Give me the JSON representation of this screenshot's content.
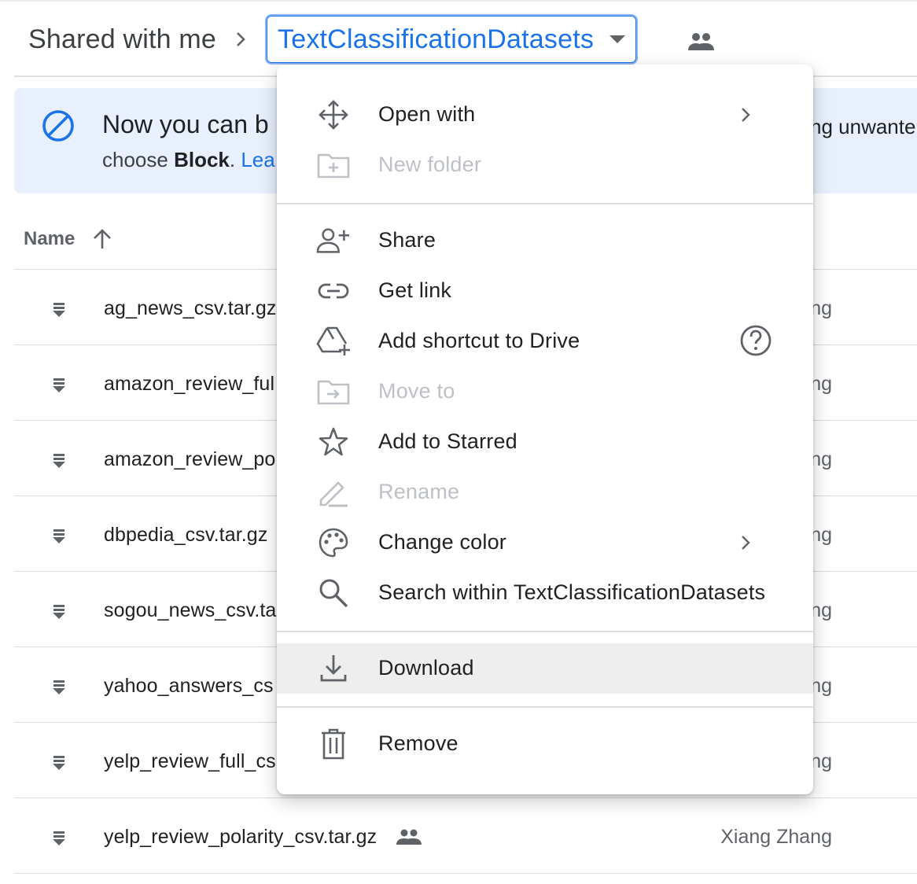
{
  "breadcrumb": {
    "root": "Shared with me",
    "separator_icon": "chevron-right-icon",
    "current": "TextClassificationDatasets",
    "caret_icon": "caret-down-icon",
    "shared_icon": "people-icon"
  },
  "banner": {
    "icon": "block-icon",
    "title": "Now you can b",
    "title_right": "ng unwante",
    "sub_text": "choose ",
    "sub_bold": "Block",
    "sub_after": ". ",
    "sub_link": "Lea"
  },
  "list": {
    "column_name": "Name",
    "sort_icon": "arrow-up-icon",
    "rows": [
      {
        "name": "ag_news_csv.tar.gz",
        "owner": "ng"
      },
      {
        "name": "amazon_review_ful",
        "owner": "ng"
      },
      {
        "name": "amazon_review_po",
        "owner": "ng"
      },
      {
        "name": "dbpedia_csv.tar.gz",
        "owner": "ng"
      },
      {
        "name": "sogou_news_csv.ta",
        "owner": "ng"
      },
      {
        "name": "yahoo_answers_cs",
        "owner": "ng"
      },
      {
        "name": "yelp_review_full_cs",
        "owner": "ng"
      },
      {
        "name": "yelp_review_polarity_csv.tar.gz",
        "owner": "Xiang Zhang"
      }
    ]
  },
  "menu": {
    "items": [
      {
        "label": "Open with",
        "icon": "move-arrows-icon",
        "disabled": false,
        "submenu": true
      },
      {
        "label": "New folder",
        "icon": "new-folder-icon",
        "disabled": true
      },
      {
        "label": "Share",
        "icon": "person-add-icon",
        "disabled": false
      },
      {
        "label": "Get link",
        "icon": "link-icon",
        "disabled": false
      },
      {
        "label": "Add shortcut to Drive",
        "icon": "drive-shortcut-icon",
        "disabled": false,
        "help": true
      },
      {
        "label": "Move to",
        "icon": "move-to-folder-icon",
        "disabled": true
      },
      {
        "label": "Add to Starred",
        "icon": "star-icon",
        "disabled": false
      },
      {
        "label": "Rename",
        "icon": "pencil-icon",
        "disabled": true
      },
      {
        "label": "Change color",
        "icon": "palette-icon",
        "disabled": false,
        "submenu": true
      },
      {
        "label": "Search within TextClassificationDatasets",
        "icon": "search-icon",
        "disabled": false
      },
      {
        "label": "Download",
        "icon": "download-icon",
        "disabled": false,
        "highlighted": true
      },
      {
        "label": "Remove",
        "icon": "trash-icon",
        "disabled": false
      }
    ]
  },
  "colors": {
    "accent": "#1a73e8",
    "banner_bg": "#e8f0fe",
    "text": "#202124",
    "disabled_text": "#bdc1c6",
    "icon": "#5f6368",
    "hover": "#eeeeee"
  }
}
